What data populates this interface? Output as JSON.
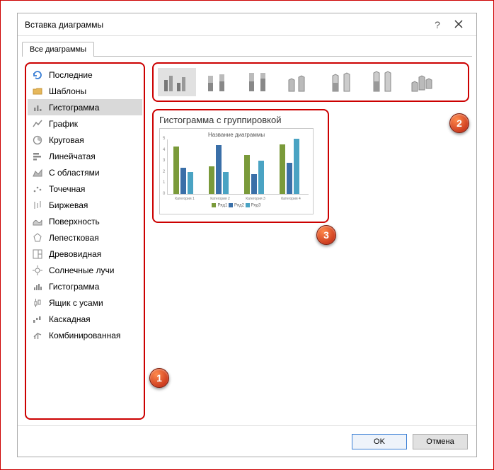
{
  "dialog": {
    "title": "Вставка диаграммы"
  },
  "tabs": {
    "active": "Все диаграммы"
  },
  "categories": [
    {
      "label": "Последние"
    },
    {
      "label": "Шаблоны"
    },
    {
      "label": "Гистограмма"
    },
    {
      "label": "График"
    },
    {
      "label": "Круговая"
    },
    {
      "label": "Линейчатая"
    },
    {
      "label": "С областями"
    },
    {
      "label": "Точечная"
    },
    {
      "label": "Биржевая"
    },
    {
      "label": "Поверхность"
    },
    {
      "label": "Лепестковая"
    },
    {
      "label": "Древовидная"
    },
    {
      "label": "Солнечные лучи"
    },
    {
      "label": "Гистограмма"
    },
    {
      "label": "Ящик с усами"
    },
    {
      "label": "Каскадная"
    },
    {
      "label": "Комбинированная"
    }
  ],
  "selected_category_index": 2,
  "subtypes_count": 7,
  "selected_subtype_index": 0,
  "preview": {
    "heading": "Гистограмма с группировкой",
    "chart_title": "Название диаграммы",
    "legend": [
      "Ряд1",
      "Ряд2",
      "Ряд3"
    ]
  },
  "footer": {
    "ok": "OK",
    "cancel": "Отмена"
  },
  "callouts": {
    "one": "1",
    "two": "2",
    "three": "3"
  },
  "chart_data": {
    "type": "bar",
    "title": "Название диаграммы",
    "xlabel": "",
    "ylabel": "",
    "ylim": [
      0,
      5
    ],
    "yticks": [
      0,
      1,
      2,
      3,
      4,
      5
    ],
    "categories": [
      "Категория 1",
      "Категория 2",
      "Категория 3",
      "Категория 4"
    ],
    "series": [
      {
        "name": "Ряд1",
        "values": [
          4.3,
          2.5,
          3.5,
          4.5
        ],
        "color": "#7a9a3a"
      },
      {
        "name": "Ряд2",
        "values": [
          2.4,
          4.4,
          1.8,
          2.8
        ],
        "color": "#3a6fa8"
      },
      {
        "name": "Ряд3",
        "values": [
          2.0,
          2.0,
          3.0,
          5.0
        ],
        "color": "#4aa3c3"
      }
    ]
  }
}
